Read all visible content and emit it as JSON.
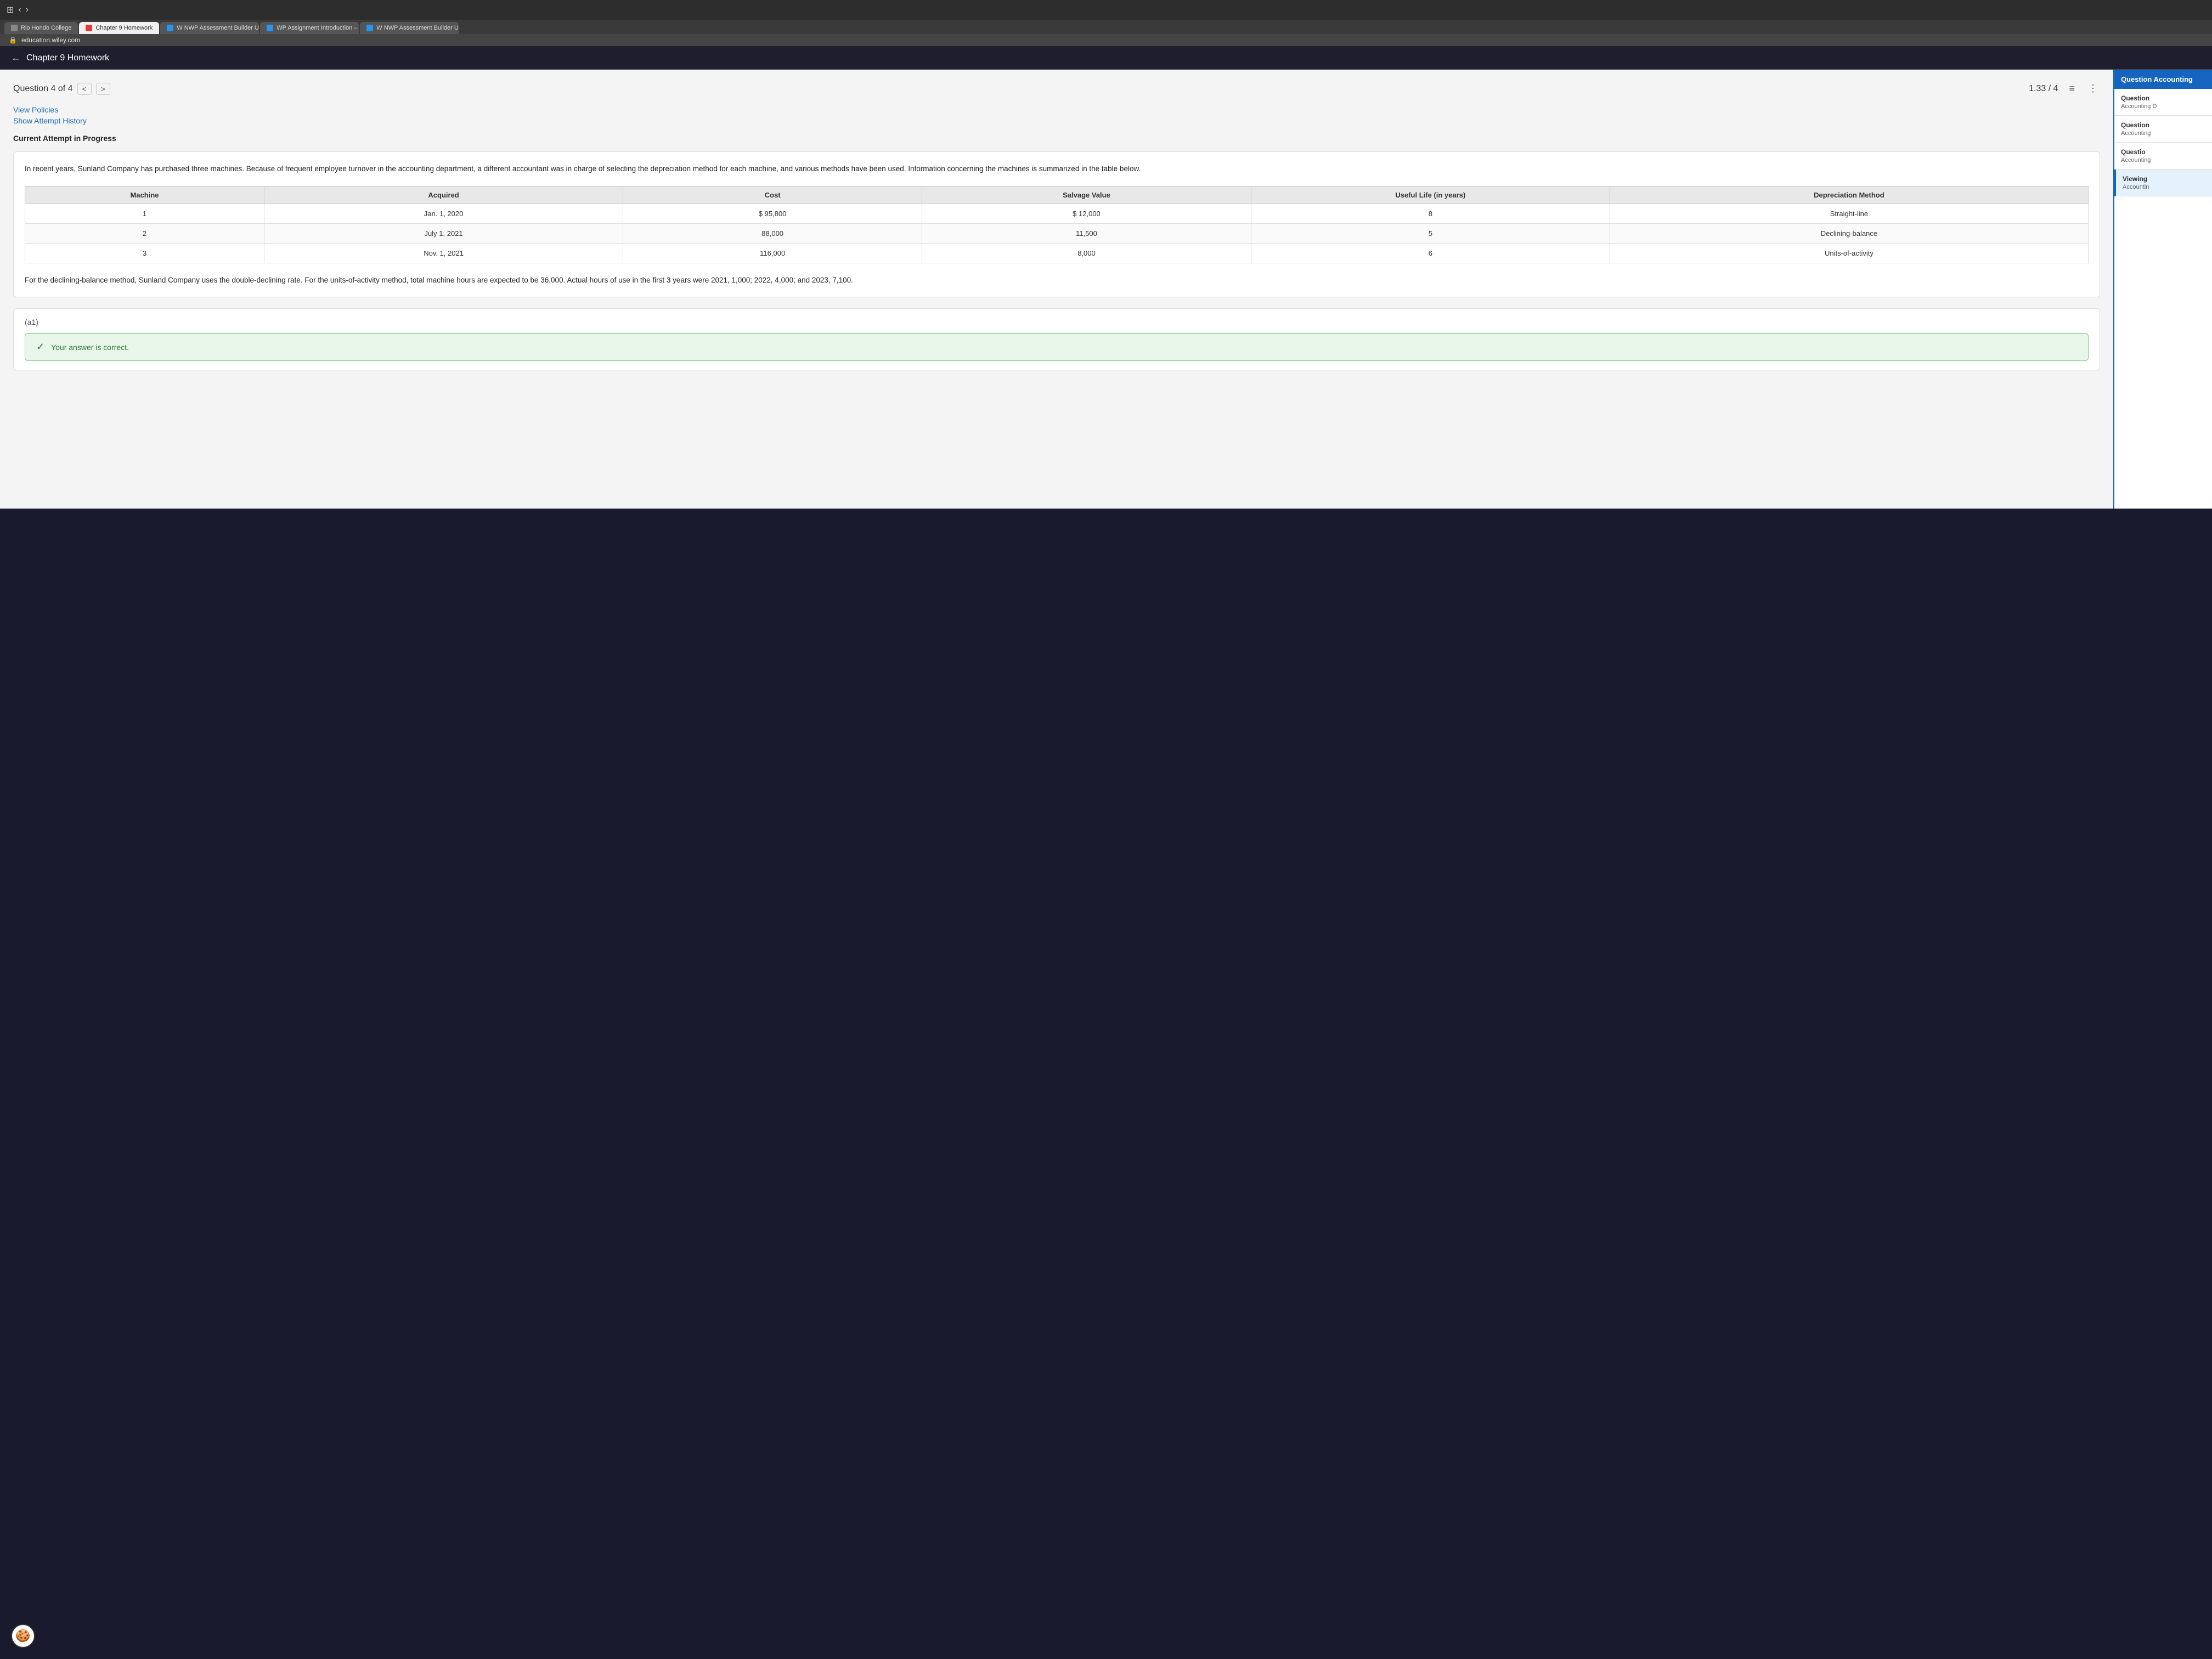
{
  "browser": {
    "address": "education.wiley.com",
    "tabs": [
      {
        "id": "tab-rio",
        "label": "Rio Hondo College",
        "favicon": "gray",
        "active": false
      },
      {
        "id": "tab-ch9",
        "label": "Chapter 9 Homework",
        "favicon": "red",
        "active": true
      },
      {
        "id": "tab-nwp1",
        "label": "W NWP Assessment Builder UI Ap...",
        "favicon": "blue",
        "active": false
      },
      {
        "id": "tab-assign",
        "label": "WP Assignment Introduction – Cha...",
        "favicon": "blue",
        "active": false
      },
      {
        "id": "tab-nwp2",
        "label": "W NWP Assessment Builder UI Ap...",
        "favicon": "blue",
        "active": false
      }
    ]
  },
  "page_header": {
    "back_label": "←",
    "title": "Chapter 9 Homework"
  },
  "question_header": {
    "label": "Question 4 of 4",
    "prev_arrow": "<",
    "next_arrow": ">",
    "score": "1.33 / 4"
  },
  "policy_links": {
    "view_policies": "View Policies",
    "show_attempt": "Show Attempt History"
  },
  "current_attempt_label": "Current Attempt in Progress",
  "question": {
    "intro_text": "In recent years, Sunland Company has purchased three machines. Because of frequent employee turnover in the accounting department, a different accountant was in charge of selecting the depreciation method for each machine, and various methods have been used. Information concerning the machines is summarized in the table below.",
    "table": {
      "headers": [
        "Machine",
        "Acquired",
        "Cost",
        "Salvage Value",
        "Useful Life (in years)",
        "Depreciation Method"
      ],
      "rows": [
        {
          "machine": "1",
          "acquired": "Jan. 1, 2020",
          "cost": "$ 95,800",
          "salvage": "$ 12,000",
          "life": "8",
          "method": "Straight-line"
        },
        {
          "machine": "2",
          "acquired": "July 1, 2021",
          "cost": "88,000",
          "salvage": "11,500",
          "life": "5",
          "method": "Declining-balance"
        },
        {
          "machine": "3",
          "acquired": "Nov. 1, 2021",
          "cost": "116,000",
          "salvage": "8,000",
          "life": "6",
          "method": "Units-of-activity"
        }
      ]
    },
    "additional_text": "For the declining-balance method, Sunland Company uses the double-declining rate. For the units-of-activity method, total machine hours are expected to be 36,000. Actual hours of use in the first 3 years were 2021, 1,000; 2022, 4,000; and 2023, 7,100."
  },
  "section_a1": {
    "label": "(a1)"
  },
  "correct_answer": {
    "text": "Your answer is correct."
  },
  "right_sidebar": {
    "header": "Question Accounting",
    "items": [
      {
        "title": "Question",
        "subtitle": "Accounting D"
      },
      {
        "title": "Question",
        "subtitle": "Accounting"
      },
      {
        "title": "Questio",
        "subtitle": "Accounting"
      },
      {
        "title": "Viewing",
        "subtitle": "Accountin"
      }
    ],
    "active_index": 3
  },
  "cookie_icon": "🍪"
}
